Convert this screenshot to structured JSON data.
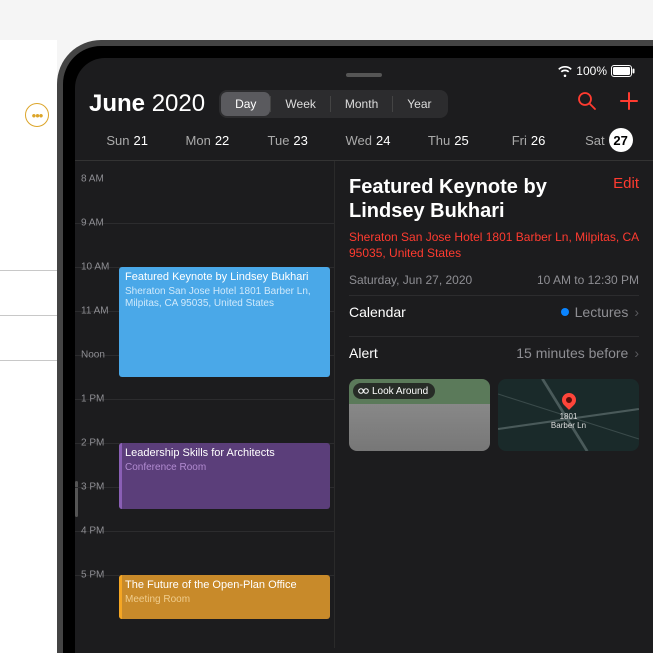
{
  "status": {
    "battery_pct": "100%"
  },
  "header": {
    "month": "June",
    "year": "2020",
    "views": {
      "day": "Day",
      "week": "Week",
      "month": "Month",
      "year": "Year"
    }
  },
  "days": [
    {
      "dow": "Sun",
      "num": "21"
    },
    {
      "dow": "Mon",
      "num": "22"
    },
    {
      "dow": "Tue",
      "num": "23"
    },
    {
      "dow": "Wed",
      "num": "24"
    },
    {
      "dow": "Thu",
      "num": "25"
    },
    {
      "dow": "Fri",
      "num": "26"
    },
    {
      "dow": "Sat",
      "num": "27",
      "selected": true
    }
  ],
  "hours": [
    "8 AM",
    "9 AM",
    "10 AM",
    "11 AM",
    "Noon",
    "1 PM",
    "2 PM",
    "3 PM",
    "4 PM",
    "5 PM"
  ],
  "events": {
    "keynote": {
      "title": "Featured Keynote by Lindsey Bukhari",
      "location": "Sheraton San Jose Hotel 1801 Barber Ln, Milpitas, CA  95035, United States"
    },
    "leadership": {
      "title": "Leadership Skills for Architects",
      "location": "Conference Room"
    },
    "openplan": {
      "title": "The Future of the Open-Plan Office",
      "location": "Meeting Room"
    }
  },
  "detail": {
    "title": "Featured Keynote by Lindsey Bukhari",
    "edit": "Edit",
    "location": "Sheraton San Jose Hotel 1801 Barber Ln, Milpitas, CA  95035, United States",
    "date": "Saturday, Jun 27, 2020",
    "time": "10 AM to 12:30 PM",
    "calendar_label": "Calendar",
    "calendar_value": "Lectures",
    "alert_label": "Alert",
    "alert_value": "15 minutes before",
    "lookaround": "Look Around",
    "map_addr_1": "1801",
    "map_addr_2": "Barber Ln"
  }
}
